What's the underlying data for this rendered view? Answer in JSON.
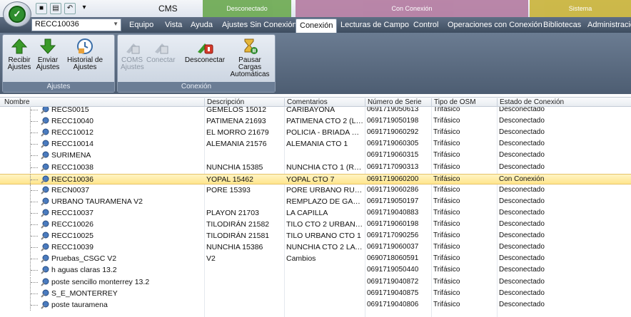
{
  "app": {
    "title": "CMS",
    "combo_value": "RECC10036"
  },
  "context_tabs": {
    "disconnected": {
      "label": "Desconectado",
      "color": "#6aa84f"
    },
    "connected": {
      "label": "Con Conexión",
      "color": "#a64d79"
    },
    "system": {
      "label": "Sistema",
      "color": "#c9b338"
    }
  },
  "tabs": [
    {
      "label": "Equipo"
    },
    {
      "label": "Vista"
    },
    {
      "label": "Ayuda"
    },
    {
      "label": "Ajustes Sin Conexión"
    },
    {
      "label": "Conexión",
      "active": true
    },
    {
      "label": "Lecturas de Campo"
    },
    {
      "label": "Control"
    },
    {
      "label": "Operaciones con Conexión"
    },
    {
      "label": "Bibliotecas"
    },
    {
      "label": "Administració"
    }
  ],
  "ribbon": {
    "group_ajustes": {
      "label": "Ajustes",
      "recibir": "Recibir\nAjustes",
      "enviar": "Enviar\nAjustes",
      "historial": "Historial de\nAjustes"
    },
    "group_conexion": {
      "label": "Conexión",
      "coms": "COMS\nAjustes",
      "conectar": "Conectar",
      "desconectar": "Desconectar",
      "pausar": "Pausar Cargas\nAutomáticas"
    }
  },
  "columns": {
    "name": "Nombre",
    "desc": "Descripción",
    "com": "Comentarios",
    "ser": "Número de Serie",
    "osm": "Tipo de OSM",
    "est": "Estado de Conexión"
  },
  "rows": [
    {
      "name": "RECS0015",
      "desc": "GEMELOS 15012",
      "com": "CARIBAYONA",
      "ser": "0691719050613",
      "osm": "Trifásico",
      "est": "Desconectado"
    },
    {
      "name": "RECC10040",
      "desc": "PATIMENA 21693",
      "com": "PATIMENA CTO 2 (LA...",
      "ser": "0691719050198",
      "osm": "Trifásico",
      "est": "Desconectado"
    },
    {
      "name": "RECC10012",
      "desc": "EL MORRO 21679",
      "com": "POLICIA - BRIADA CT...",
      "ser": "0691719060292",
      "osm": "Trifásico",
      "est": "Desconectado"
    },
    {
      "name": "RECC10014",
      "desc": "ALEMANIA 21576",
      "com": "ALEMANIA CTO 1",
      "ser": "0691719060305",
      "osm": "Trifásico",
      "est": "Desconectado"
    },
    {
      "name": "SURIMENA",
      "desc": "",
      "com": "",
      "ser": "0691719060315",
      "osm": "Trifásico",
      "est": "Desconectado"
    },
    {
      "name": "RECC10038",
      "desc": "NUNCHIA 15385",
      "com": "NUNCHIA CTO 1 (RU...",
      "ser": "0691717090313",
      "osm": "Trifásico",
      "est": "Desconectado"
    },
    {
      "name": "RECC10036",
      "desc": "YOPAL 15462",
      "com": "YOPAL CTO 7",
      "ser": "0691719060200",
      "osm": "Trifásico",
      "est": "Con Conexión",
      "selected": true
    },
    {
      "name": "RECN0037",
      "desc": "PORE 15393",
      "com": "PORE URBANO RUR...",
      "ser": "0691719060286",
      "osm": "Trifásico",
      "est": "Desconectado"
    },
    {
      "name": "URBANO TAURAMENA V2",
      "desc": "",
      "com": "REMPLAZO DE GABI...",
      "ser": "0691719050197",
      "osm": "Trifásico",
      "est": "Desconectado"
    },
    {
      "name": "RECC10037",
      "desc": "PLAYON 21703",
      "com": "LA CAPILLA",
      "ser": "0691719040883",
      "osm": "Trifásico",
      "est": "Desconectado"
    },
    {
      "name": "RECC10026",
      "desc": "TILODIRÁN 21582",
      "com": "TILO CTO 2 URBANO...",
      "ser": "0691719060198",
      "osm": "Trifásico",
      "est": "Desconectado"
    },
    {
      "name": "RECC10025",
      "desc": "TILODIRÁN 21581",
      "com": "TILO URBANO CTO 1",
      "ser": "0691717090256",
      "osm": "Trifásico",
      "est": "Desconectado"
    },
    {
      "name": "RECC10039",
      "desc": "NUNCHIA 15386",
      "com": "NUNCHIA CTO 2 LA P...",
      "ser": "0691719060037",
      "osm": "Trifásico",
      "est": "Desconectado"
    },
    {
      "name": "Pruebas_CSGC V2",
      "desc": "V2",
      "com": "Cambios",
      "ser": "0690718060591",
      "osm": "Trifásico",
      "est": "Desconectado"
    },
    {
      "name": "h aguas claras 13.2",
      "desc": "",
      "com": "",
      "ser": "0691719050440",
      "osm": "Trifásico",
      "est": "Desconectado"
    },
    {
      "name": "poste sencillo monterrey 13.2",
      "desc": "",
      "com": "",
      "ser": "0691719040872",
      "osm": "Trifásico",
      "est": "Desconectado"
    },
    {
      "name": "S_E_MONTERREY",
      "desc": "",
      "com": "",
      "ser": "0691719040875",
      "osm": "Trifásico",
      "est": "Desconectado"
    },
    {
      "name": "poste tauramena",
      "desc": "",
      "com": "",
      "ser": "0691719040806",
      "osm": "Trifásico",
      "est": "Desconectado"
    }
  ]
}
